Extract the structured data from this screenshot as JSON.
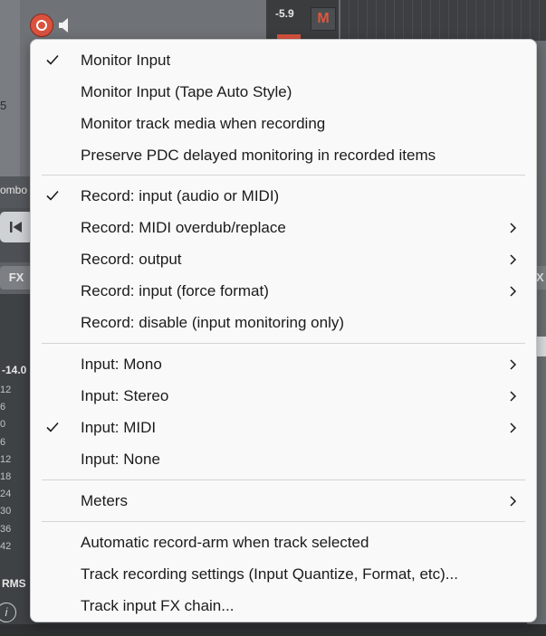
{
  "background": {
    "volume_readout": "-5.9",
    "mute_label": "M",
    "track_number_fragment": "5",
    "combo_fragment": "ombo",
    "fx_label": "FX",
    "fx_label_right": "FX",
    "meter_db_top": "-14.0",
    "meter_scale": [
      "12",
      "6",
      "0",
      "6",
      "12",
      "18",
      "24",
      "30",
      "36",
      "42"
    ],
    "rms_label": "RMS",
    "info_icon": "i"
  },
  "icons": {
    "record-arm": "record-circle-icon",
    "monitor": "speaker-icon",
    "check": "check-icon",
    "submenu": "chevron-right-icon",
    "skip-back": "skip-to-start-icon"
  },
  "colors": {
    "record_red": "#d9523e",
    "menu_bg": "#f9f9f9",
    "menu_text": "#1b1b1b",
    "separator": "#d4d4d4"
  },
  "menu": {
    "items": [
      {
        "label": "Monitor Input",
        "checked": true,
        "submenu": false
      },
      {
        "label": "Monitor Input (Tape Auto Style)",
        "checked": false,
        "submenu": false
      },
      {
        "label": "Monitor track media when recording",
        "checked": false,
        "submenu": false
      },
      {
        "label": "Preserve PDC delayed monitoring in recorded items",
        "checked": false,
        "submenu": false
      },
      {
        "label": "Record: input (audio or MIDI)",
        "checked": true,
        "submenu": false
      },
      {
        "label": "Record: MIDI overdub/replace",
        "checked": false,
        "submenu": true
      },
      {
        "label": "Record: output",
        "checked": false,
        "submenu": true
      },
      {
        "label": "Record: input (force format)",
        "checked": false,
        "submenu": true
      },
      {
        "label": "Record: disable (input monitoring only)",
        "checked": false,
        "submenu": false
      },
      {
        "label": "Input: Mono",
        "checked": false,
        "submenu": true
      },
      {
        "label": "Input: Stereo",
        "checked": false,
        "submenu": true
      },
      {
        "label": "Input: MIDI",
        "checked": true,
        "submenu": true
      },
      {
        "label": "Input: None",
        "checked": false,
        "submenu": false
      },
      {
        "label": "Meters",
        "checked": false,
        "submenu": true
      },
      {
        "label": "Automatic record-arm when track selected",
        "checked": false,
        "submenu": false
      },
      {
        "label": "Track recording settings (Input Quantize, Format, etc)...",
        "checked": false,
        "submenu": false
      },
      {
        "label": "Track input FX chain...",
        "checked": false,
        "submenu": false
      }
    ]
  }
}
